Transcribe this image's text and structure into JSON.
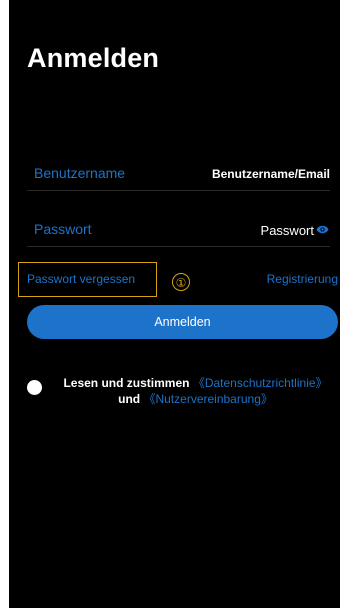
{
  "header": {
    "title": "Anmelden"
  },
  "form": {
    "username": {
      "label": "Benutzername",
      "placeholder": "Benutzername/Email"
    },
    "password": {
      "label": "Passwort",
      "placeholder": "Passwort"
    },
    "forgot_password": "Passwort vergessen",
    "annotation_marker": "①",
    "register": "Registrierung",
    "submit": "Anmelden"
  },
  "agreement": {
    "prefix": "Lesen und zustimmen",
    "privacy_link": "《Datenschutzrichtlinie》",
    "conjunction": "und",
    "terms_link": "《Nutzervereinbarung》"
  },
  "colors": {
    "background": "#000000",
    "accent": "#1c73c9",
    "highlight": "#d5a50c",
    "text": "#ffffff"
  },
  "icons": {
    "password_visibility": "eye-icon"
  }
}
